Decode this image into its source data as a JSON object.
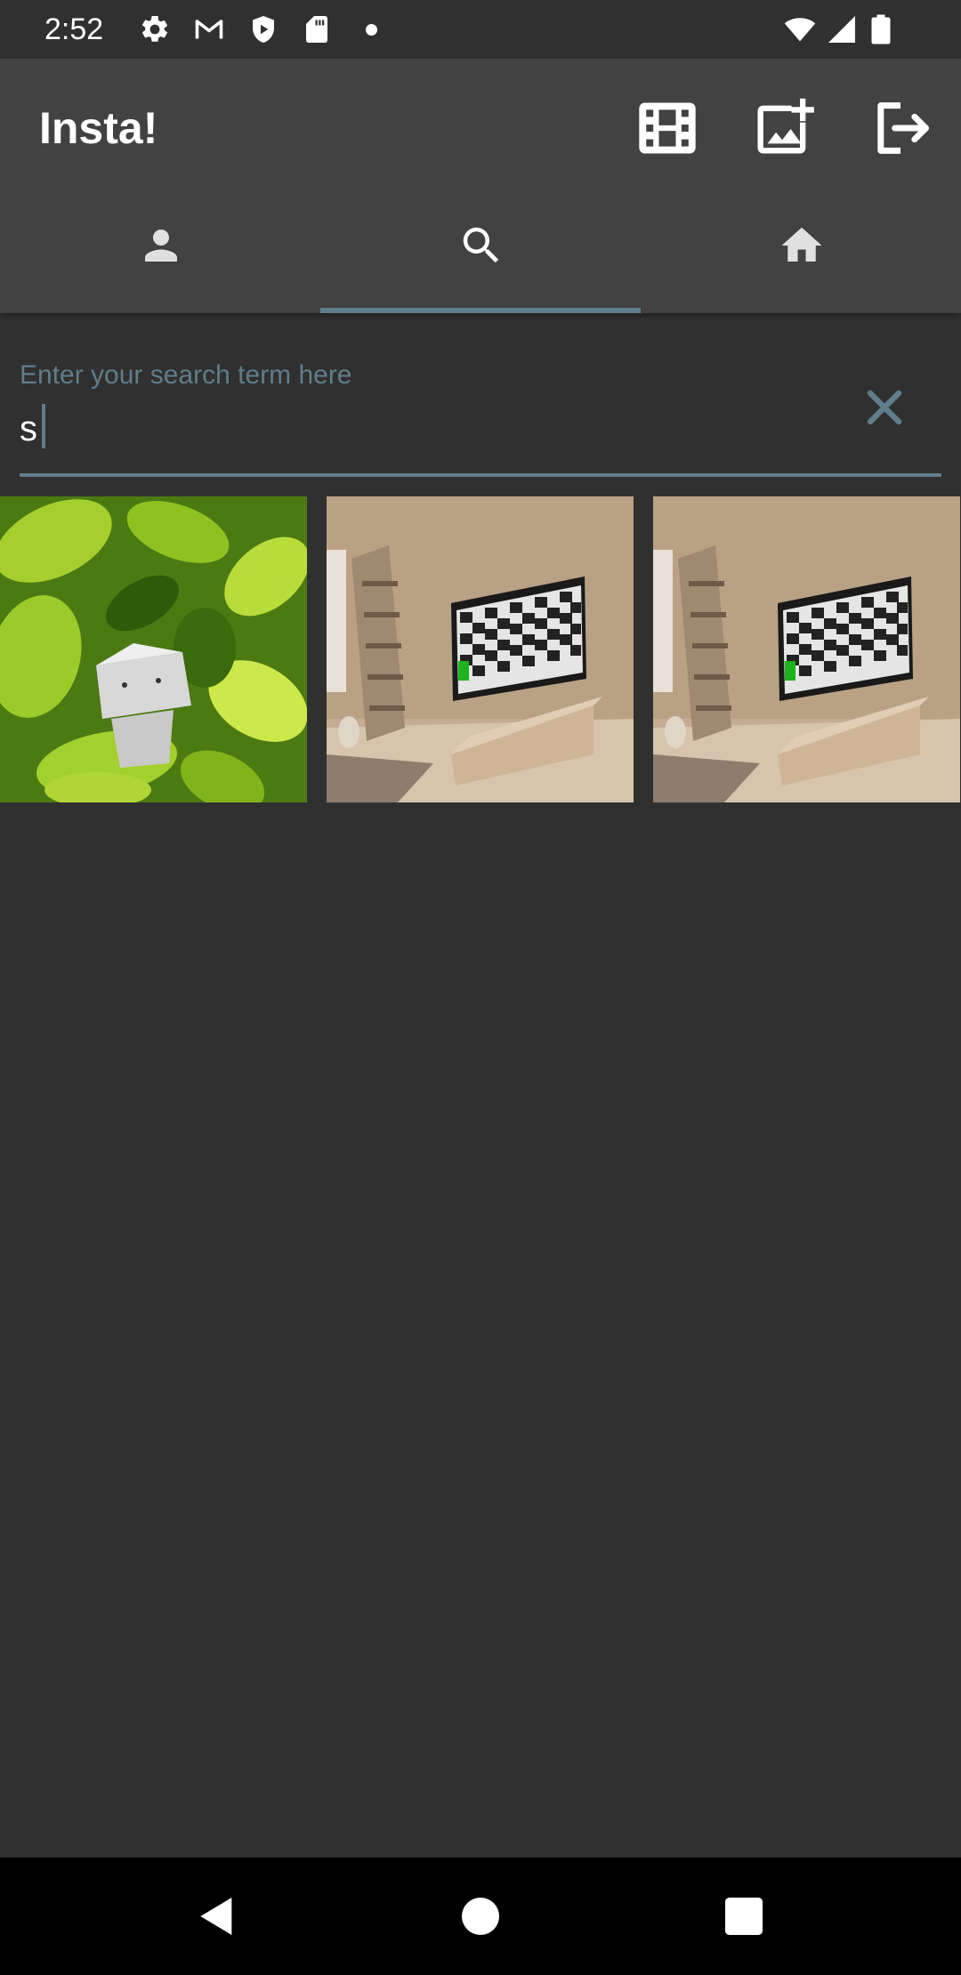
{
  "status_bar": {
    "time": "2:52",
    "icons": [
      "gear-icon",
      "gmail-icon",
      "shield-play-icon",
      "sd-card-icon",
      "notification-dot",
      "wifi-icon",
      "signal-icon",
      "battery-icon"
    ]
  },
  "app_bar": {
    "title": "Insta!",
    "actions": [
      "film-icon",
      "add-photo-icon",
      "logout-icon"
    ]
  },
  "tabs": [
    {
      "name": "profile",
      "icon": "person-icon",
      "selected": false
    },
    {
      "name": "search",
      "icon": "search-icon",
      "selected": true
    },
    {
      "name": "home",
      "icon": "home-icon",
      "selected": false
    }
  ],
  "search": {
    "label": "Enter your search term here",
    "value": "s",
    "clear_icon": "close-icon"
  },
  "results": [
    {
      "subject": "paper robot figure among green leaves"
    },
    {
      "subject": "wooden room with tv showing checkerboard"
    },
    {
      "subject": "wooden room with tv showing checkerboard"
    }
  ],
  "nav_bar": {
    "buttons": [
      "back-icon",
      "home-circle-icon",
      "recents-icon"
    ]
  },
  "colors": {
    "background": "#303030",
    "app_bar": "#424242",
    "accent": "#607d8b",
    "nav_bar": "#000000"
  }
}
